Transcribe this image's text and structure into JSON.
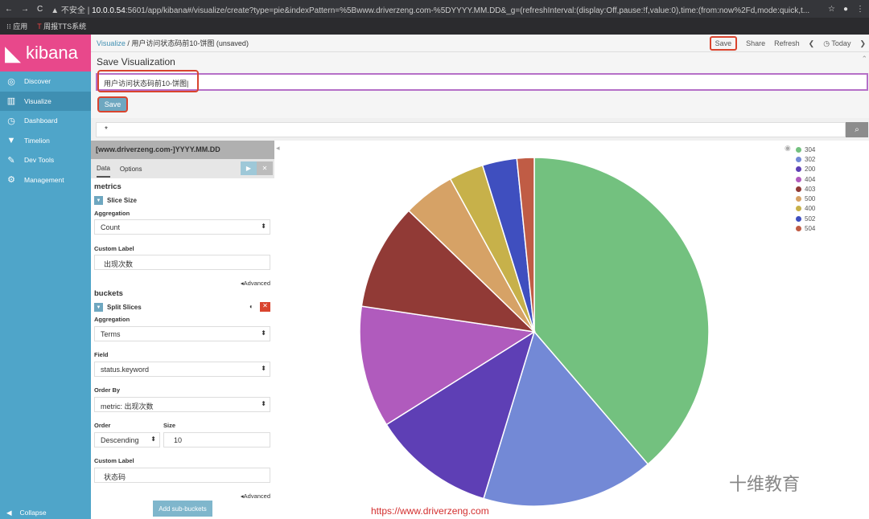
{
  "browser": {
    "insecure": "不安全",
    "url_host": "10.0.0.54",
    "url_rest": ":5601/app/kibana#/visualize/create?type=pie&indexPattern=%5Bwww.driverzeng.com-%5DYYYY.MM.DD&_g=(refreshInterval:(display:Off,pause:!f,value:0),time:(from:now%2Fd,mode:quick,t...",
    "bookmarks": [
      "应用",
      "周报TTS系统"
    ]
  },
  "sidebar": {
    "logo": "kibana",
    "items": [
      {
        "label": "Discover",
        "icon": "compass-icon"
      },
      {
        "label": "Visualize",
        "icon": "bar-chart-icon"
      },
      {
        "label": "Dashboard",
        "icon": "dashboard-icon"
      },
      {
        "label": "Timelion",
        "icon": "timelion-icon"
      },
      {
        "label": "Dev Tools",
        "icon": "wrench-icon"
      },
      {
        "label": "Management",
        "icon": "gear-icon"
      }
    ],
    "active": "Visualize",
    "collapse": "Collapse"
  },
  "topbar": {
    "crumb": "Visualize",
    "sep": "/",
    "title": "用户访问状态码前10-饼图 (unsaved)",
    "save": "Save",
    "share": "Share",
    "refresh": "Refresh",
    "today": "Today"
  },
  "save_panel": {
    "title": "Save Visualization",
    "name_value": "用户访问状态码前10-饼图",
    "save": "Save"
  },
  "query": {
    "value": "*"
  },
  "editor": {
    "index": "[www.driverzeng.com-]YYYY.MM.DD",
    "tabs": [
      "Data",
      "Options"
    ],
    "metrics": {
      "heading": "metrics",
      "agg_title": "Slice Size",
      "aggregation_label": "Aggregation",
      "aggregation": "Count",
      "custom_label_label": "Custom Label",
      "custom_label": "出现次数",
      "advanced": "Advanced"
    },
    "buckets": {
      "heading": "buckets",
      "agg_title": "Split Slices",
      "aggregation_label": "Aggregation",
      "aggregation": "Terms",
      "field_label": "Field",
      "field": "status.keyword",
      "order_by_label": "Order By",
      "order_by": "metric: 出现次数",
      "order_label": "Order",
      "order": "Descending",
      "size_label": "Size",
      "size": "10",
      "custom_label_label": "Custom Label",
      "custom_label": "状态码",
      "advanced": "Advanced"
    },
    "add_sub": "Add sub-buckets"
  },
  "chart_data": {
    "type": "pie",
    "categories": [
      "304",
      "302",
      "200",
      "404",
      "403",
      "500",
      "400",
      "502",
      "504"
    ],
    "values": [
      38.8,
      16.0,
      11.4,
      11.3,
      9.9,
      4.8,
      3.2,
      3.2,
      1.6
    ],
    "unit": "approx. percent share",
    "colors": [
      "#73c17f",
      "#7389d6",
      "#5e3fb5",
      "#b05bbd",
      "#913a36",
      "#d6a266",
      "#c7b14a",
      "#3f4fbf",
      "#c05c45"
    ],
    "legend": "top-right"
  },
  "overlay": {
    "watermark": "https://www.driverzeng.com",
    "brand": "十维教育"
  }
}
